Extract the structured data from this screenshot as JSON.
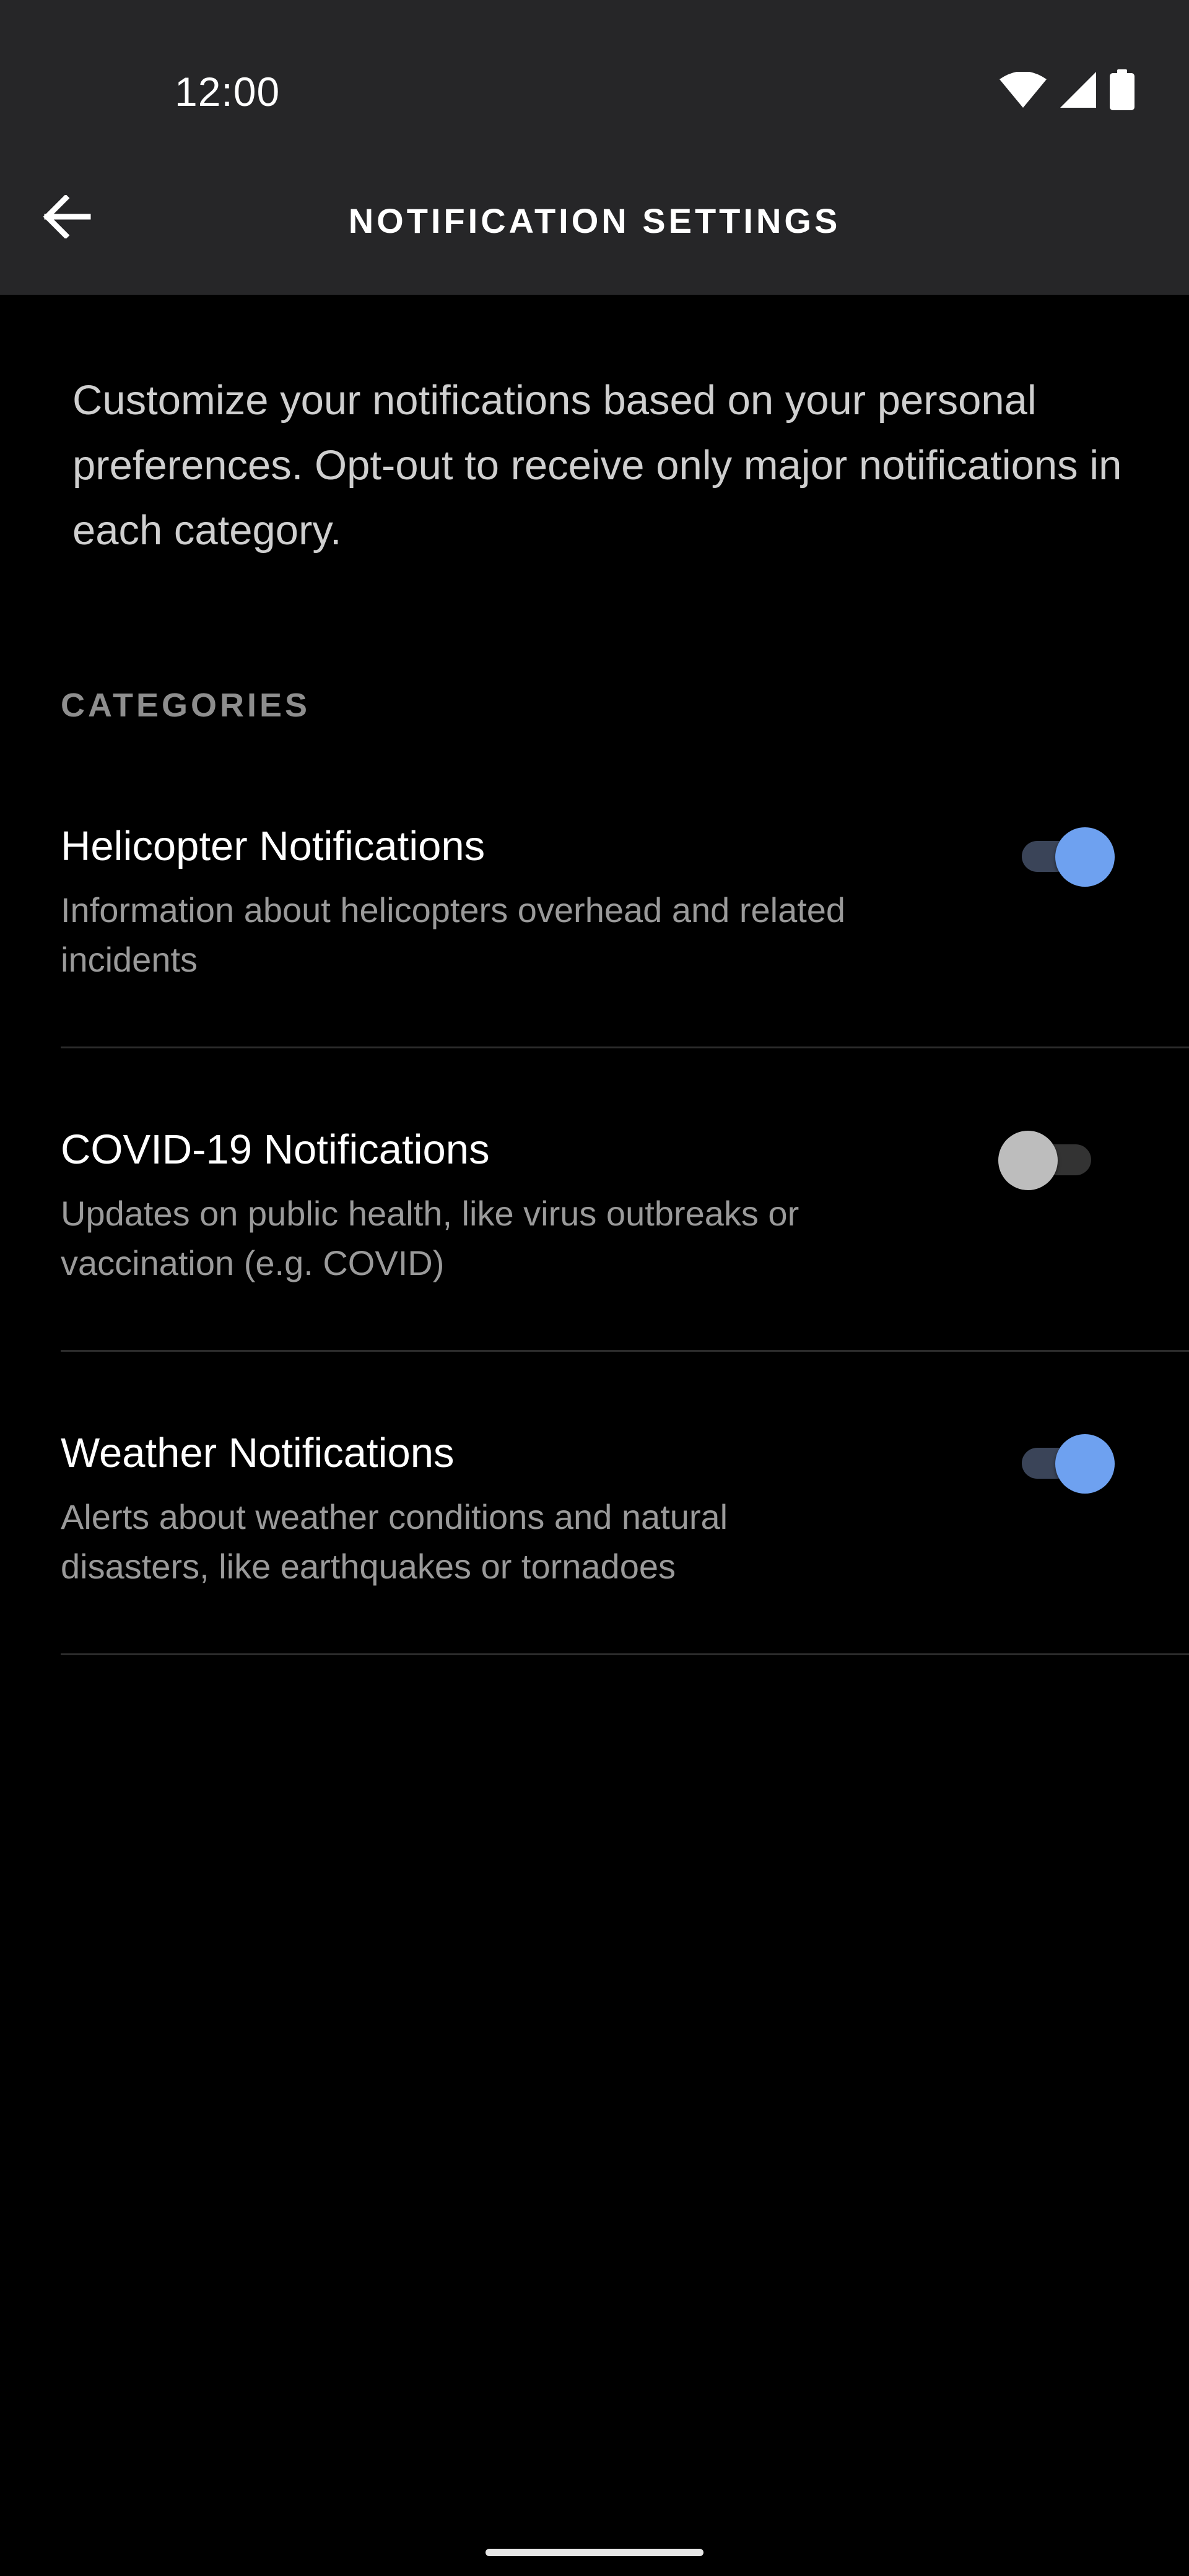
{
  "status_bar": {
    "time": "12:00",
    "icons": [
      "wifi-icon",
      "cellular-signal-icon",
      "battery-icon"
    ]
  },
  "header": {
    "back_icon": "arrow-left-icon",
    "title": "NOTIFICATION SETTINGS"
  },
  "intro_text": "Customize your notifications based on your personal preferences. Opt-out to receive only major notifications in each category.",
  "section_label": "CATEGORIES",
  "categories": [
    {
      "title": "Helicopter Notifications",
      "description": "Information about helicopters overhead and related incidents",
      "enabled": true
    },
    {
      "title": "COVID-19 Notifications",
      "description": "Updates on public health, like virus outbreaks or vaccination (e.g. COVID)",
      "enabled": false
    },
    {
      "title": "Weather Notifications",
      "description": "Alerts about weather conditions and natural disasters, like earthquakes or tornadoes",
      "enabled": true
    }
  ],
  "colors": {
    "background": "#000000",
    "app_bar": "#262628",
    "toggle_on_thumb": "#6ea1f0",
    "toggle_on_track": "#3a4458",
    "toggle_off_thumb": "#bdbdbd",
    "toggle_off_track": "#333333",
    "divider": "#2c2c2c"
  }
}
